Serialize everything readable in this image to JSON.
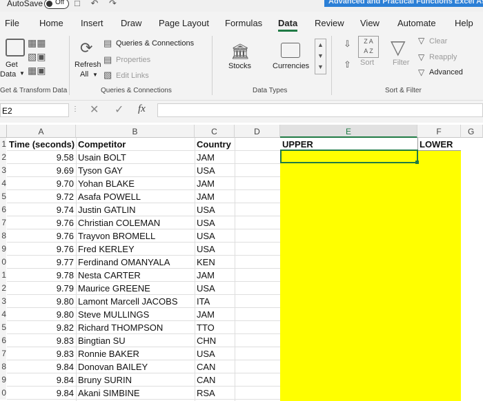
{
  "titlebar": {
    "autosave": "AutoSave",
    "toggle": "Off",
    "doc_title": "Advanced and Practical Functions Excel Assign"
  },
  "tabs": [
    "File",
    "Home",
    "Insert",
    "Draw",
    "Page Layout",
    "Formulas",
    "Data",
    "Review",
    "View",
    "Automate",
    "Help"
  ],
  "ribbon": {
    "get_data": "Get",
    "get_data2": "Data",
    "refresh": "Refresh",
    "refresh_all": "All",
    "queries_connections": "Queries & Connections",
    "properties": "Properties",
    "edit_links": "Edit Links",
    "stocks": "Stocks",
    "currencies": "Currencies",
    "sort": "Sort",
    "filter": "Filter",
    "clear": "Clear",
    "reapply": "Reapply",
    "advanced": "Advanced",
    "groups": {
      "get_transform": "Get & Transform Data",
      "queries": "Queries & Connections",
      "data_types": "Data Types",
      "sort_filter": "Sort & Filter"
    }
  },
  "formula_bar": {
    "name_box": "E2",
    "fx": "fx",
    "value": ""
  },
  "columns": [
    "A",
    "B",
    "C",
    "D",
    "E",
    "F"
  ],
  "row_numbers": [
    "1",
    "2",
    "3",
    "4",
    "5",
    "6",
    "7",
    "8",
    "9",
    "0",
    "1",
    "2",
    "3",
    "4",
    "5",
    "6",
    "7",
    "8",
    "9",
    "0"
  ],
  "headers": {
    "time": "Time (seconds)",
    "competitor": "Competitor",
    "country": "Country",
    "upper": "UPPER",
    "lower": "LOWER"
  },
  "rows": [
    {
      "time": "9.58",
      "name": "Usain BOLT",
      "country": "JAM"
    },
    {
      "time": "9.69",
      "name": "Tyson GAY",
      "country": "USA"
    },
    {
      "time": "9.70",
      "name": "Yohan BLAKE",
      "country": "JAM"
    },
    {
      "time": "9.72",
      "name": "Asafa POWELL",
      "country": "JAM"
    },
    {
      "time": "9.74",
      "name": "Justin GATLIN",
      "country": "USA"
    },
    {
      "time": "9.76",
      "name": "Christian COLEMAN",
      "country": "USA"
    },
    {
      "time": "9.76",
      "name": "Trayvon BROMELL",
      "country": "USA"
    },
    {
      "time": "9.76",
      "name": "Fred KERLEY",
      "country": "USA"
    },
    {
      "time": "9.77",
      "name": "Ferdinand OMANYALA",
      "country": "KEN"
    },
    {
      "time": "9.78",
      "name": "Nesta CARTER",
      "country": "JAM"
    },
    {
      "time": "9.79",
      "name": "Maurice GREENE",
      "country": "USA"
    },
    {
      "time": "9.80",
      "name": "Lamont Marcell JACOBS",
      "country": "ITA"
    },
    {
      "time": "9.80",
      "name": "Steve MULLINGS",
      "country": "JAM"
    },
    {
      "time": "9.82",
      "name": "Richard THOMPSON",
      "country": "TTO"
    },
    {
      "time": "9.83",
      "name": "Bingtian SU",
      "country": "CHN"
    },
    {
      "time": "9.83",
      "name": "Ronnie BAKER",
      "country": "USA"
    },
    {
      "time": "9.84",
      "name": "Donovan BAILEY",
      "country": "CAN"
    },
    {
      "time": "9.84",
      "name": "Bruny SURIN",
      "country": "CAN"
    },
    {
      "time": "9.84",
      "name": "Akani SIMBINE",
      "country": "RSA"
    }
  ],
  "colors": {
    "highlight": "#ffff00",
    "accent": "#1f7a44"
  }
}
